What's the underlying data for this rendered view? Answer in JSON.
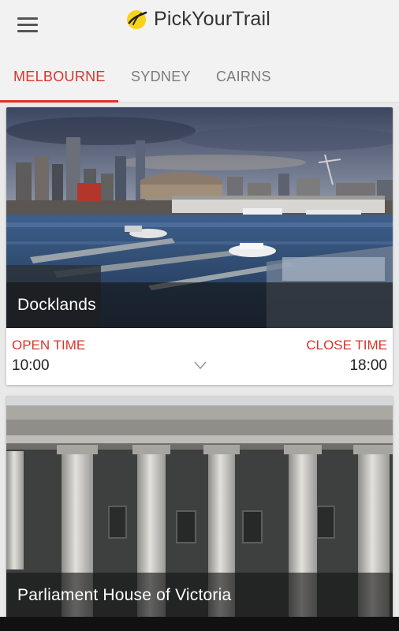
{
  "app": {
    "title": "PickYourTrail"
  },
  "tabs": [
    {
      "label": "MELBOURNE",
      "active": true
    },
    {
      "label": "SYDNEY",
      "active": false
    },
    {
      "label": "CAIRNS",
      "active": false
    }
  ],
  "cards": [
    {
      "title": "Docklands",
      "open_label": "OPEN TIME",
      "open_time": "10:00",
      "close_label": "CLOSE TIME",
      "close_time": "18:00"
    },
    {
      "title": "Parliament House of Victoria"
    }
  ],
  "colors": {
    "accent": "#d9342b",
    "logo_yellow": "#f7d21b"
  },
  "icons": [
    "menu-icon",
    "logo-icon",
    "chevron-down-icon"
  ]
}
